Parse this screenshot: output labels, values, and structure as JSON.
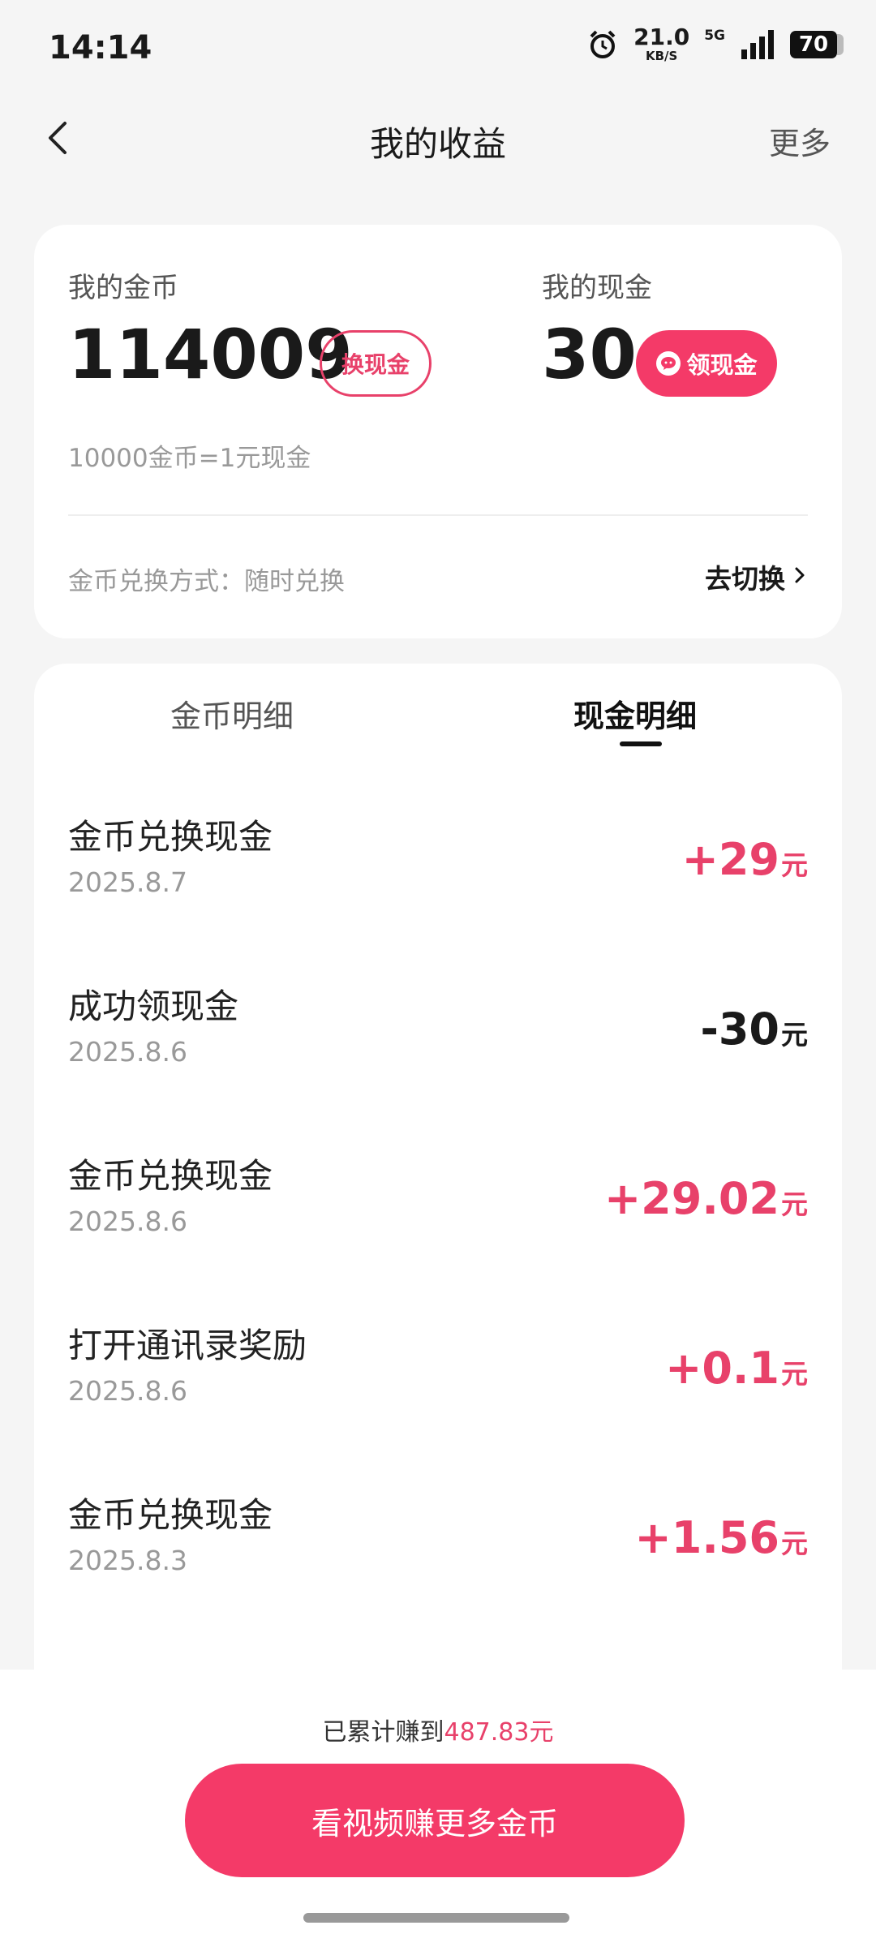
{
  "status": {
    "time": "14:14",
    "net_speed": "21.0",
    "net_speed_unit": "KB/S",
    "network": "5G",
    "battery": "70"
  },
  "header": {
    "title": "我的收益",
    "more": "更多"
  },
  "balance": {
    "coin_label": "我的金币",
    "coin_value": "114009",
    "exchange_button": "换现金",
    "cash_label": "我的现金",
    "cash_value": "30",
    "withdraw_button": "领现金",
    "rate_note": "10000金币=1元现金",
    "exchange_mode": "金币兑换方式：随时兑换",
    "switch_link": "去切换"
  },
  "tabs": {
    "coins": "金币明细",
    "cash": "现金明细",
    "active": "cash"
  },
  "transactions": [
    {
      "title": "金币兑换现金",
      "date": "2025.8.7",
      "amount": "+29",
      "unit": "元"
    },
    {
      "title": "成功领现金",
      "date": "2025.8.6",
      "amount": "-30",
      "unit": "元"
    },
    {
      "title": "金币兑换现金",
      "date": "2025.8.6",
      "amount": "+29.02",
      "unit": "元"
    },
    {
      "title": "打开通讯录奖励",
      "date": "2025.8.6",
      "amount": "+0.1",
      "unit": "元"
    },
    {
      "title": "金币兑换现金",
      "date": "2025.8.3",
      "amount": "+1.56",
      "unit": "元"
    }
  ],
  "footer": {
    "total_prefix": "已累计赚到",
    "total_amount": "487.83元",
    "cta_button": "看视频赚更多金币"
  },
  "colors": {
    "accent": "#f43a68",
    "positive": "#e8416a"
  }
}
